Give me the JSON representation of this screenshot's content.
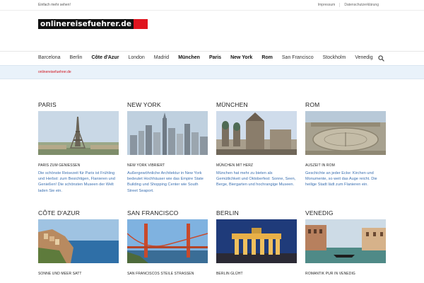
{
  "header": {
    "tagline": "Einfach mehr sehen!",
    "links": [
      "Impressum",
      "Datenschutzerklärung"
    ],
    "logo_text": "onlinereisefuehrer.de"
  },
  "nav": {
    "items": [
      {
        "label": "Barcelona",
        "bold": false
      },
      {
        "label": "Berlin",
        "bold": false
      },
      {
        "label": "Côte d'Azur",
        "bold": true
      },
      {
        "label": "London",
        "bold": false
      },
      {
        "label": "Madrid",
        "bold": false
      },
      {
        "label": "München",
        "bold": true
      },
      {
        "label": "Paris",
        "bold": true
      },
      {
        "label": "New York",
        "bold": true
      },
      {
        "label": "Rom",
        "bold": true
      },
      {
        "label": "San Francisco",
        "bold": false
      },
      {
        "label": "Stockholm",
        "bold": false
      },
      {
        "label": "Venedig",
        "bold": false
      }
    ],
    "search_icon": "search-icon"
  },
  "breadcrumb": "onlinereisefuehrer.de",
  "cards": [
    {
      "title": "PARIS",
      "subtitle": "PARIS ZUM GENIESSEN",
      "desc": "Die schönste Reisezeit für Paris ist Frühling und Herbst: zum Besichtigen, Flanieren und Genießen! Die schönsten Museen der Welt laden Sie ein."
    },
    {
      "title": "NEW YORK",
      "subtitle": "NEW YORK VIBRIERT",
      "desc": "Außergewöhnliche Architektur in New York bedeutet Hochhäuser wie das Empire State Building und Shopping Center wie South Street Seaport."
    },
    {
      "title": "MÜNCHEN",
      "subtitle": "MÜNCHEN MIT HERZ",
      "desc": "München hat mehr zu bieten als Gemütlichkeit und Oktoberfest: Sonne, Seen, Berge, Biergarten und hochrangige Museen."
    },
    {
      "title": "ROM",
      "subtitle": "AUSZEIT IN ROM",
      "desc": "Geschichte an jeder Ecke: Kirchen und Monumente, so weit das Auge reicht. Die heilige Stadt lädt zum Flanieren ein."
    },
    {
      "title": "CÔTE D'AZUR",
      "subtitle": "SONNE UND MEER SATT",
      "desc": ""
    },
    {
      "title": "SAN FRANCISCO",
      "subtitle": "SAN FRANCISCOS STEILE STRASSEN",
      "desc": ""
    },
    {
      "title": "BERLIN",
      "subtitle": "BERLIN GLÜHT",
      "desc": ""
    },
    {
      "title": "VENEDIG",
      "subtitle": "ROMANTIK PUR IN VENEDIG",
      "desc": ""
    }
  ],
  "colors": {
    "accent_red": "#e0141e",
    "link_blue": "#3a6fb0",
    "breadcrumb_bg": "#e9f2fa"
  }
}
